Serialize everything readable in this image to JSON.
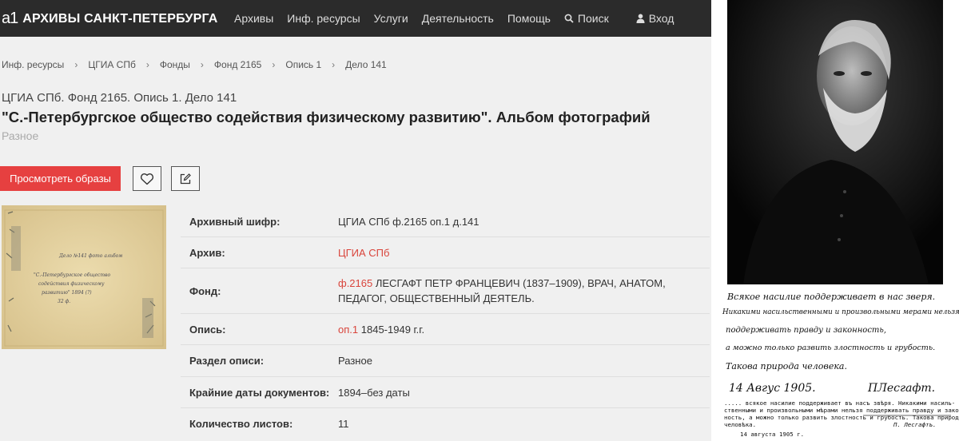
{
  "header": {
    "logo_mark": "a1",
    "site_title": "АРХИВЫ САНКТ-ПЕТЕРБУРГА",
    "menu": [
      "Архивы",
      "Инф. ресурсы",
      "Услуги",
      "Деятельность",
      "Помощь",
      "Поиск",
      "Вход"
    ]
  },
  "breadcrumb": [
    "Инф. ресурсы",
    "ЦГИА СПб",
    "Фонды",
    "Фонд 2165",
    "Опись 1",
    "Дело 141"
  ],
  "record": {
    "subtitle": "ЦГИА СПб. Фонд 2165. Опись 1. Дело 141",
    "title": "\"С.-Петербургское общество содействия физическому развитию\". Альбом фотографий",
    "category": "Разное"
  },
  "actions": {
    "view_images": "Просмотреть образы"
  },
  "thumbnail_text": [
    "Дело №141 фото альбом",
    "\"С.-Петербургское общество",
    "содействия физическому",
    "развитию\" 1894 (?)",
    "32 ф."
  ],
  "properties": [
    {
      "key": "Архивный шифр:",
      "value": "ЦГИА СПб ф.2165 оп.1 д.141"
    },
    {
      "key": "Архив:",
      "link": "ЦГИА СПб"
    },
    {
      "key": "Фонд:",
      "link": "ф.2165",
      "value": "ЛЕСГАФТ ПЕТР ФРАНЦЕВИЧ (1837–1909), ВРАЧ, АНАТОМ, ПЕДАГОГ, ОБЩЕСТВЕННЫЙ ДЕЯТЕЛЬ."
    },
    {
      "key": "Опись:",
      "link": "оп.1",
      "value": "1845-1949 г.г."
    },
    {
      "key": "Раздел описи:",
      "value": "Разное"
    },
    {
      "key": "Крайние даты документов:",
      "value": "1894–без даты"
    },
    {
      "key": "Количество листов:",
      "value": "11"
    }
  ],
  "portrait": {
    "handwriting": [
      "Всякое насилие поддерживает в нас зверя.",
      "Никакими насильственными и произвольными мерами нельзя",
      "поддерживать правду и законность,",
      "а можно только развить злостность и грубость.",
      "Такова природа человека.",
      "14 Авгус 1905.",
      "ПЛесгафт."
    ],
    "caption": [
      "..... всякое насилие поддерживает въ насъ звѣря. Никакими насиль-",
      "ственными и произвольными мѣрами нельзя поддерживать правду и закон-",
      "ность, а можно только развить злостность и грубость. Такова природа",
      "человѣка."
    ],
    "signature": "П. Лесгафтъ.",
    "date": "14 августа 1905 г."
  },
  "colors": {
    "accent": "#e64040",
    "link": "#d9443b",
    "nav_bg": "#2b2b2b"
  }
}
